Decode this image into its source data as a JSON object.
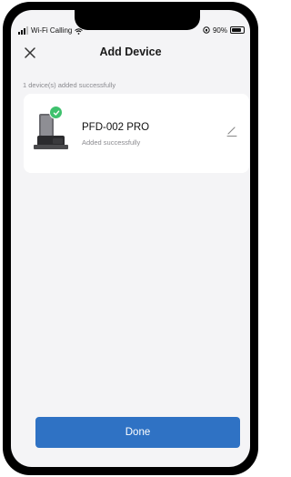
{
  "status_bar": {
    "carrier": "Wi-Fi Calling",
    "battery": "90%",
    "icons": [
      "signal-icon",
      "wifi-icon",
      "orientation-lock-icon",
      "battery-icon"
    ]
  },
  "header": {
    "title": "Add Device",
    "close_icon": "close-icon"
  },
  "summary": "1 device(s) added successfully",
  "devices": [
    {
      "name": "PFD-002 PRO",
      "status": "Added successfully",
      "icon": "pet-feeder-icon",
      "badge_icon": "check-icon",
      "action_icon": "edit-icon"
    }
  ],
  "done_label": "Done",
  "colors": {
    "accent": "#2f72c4",
    "success": "#3ec16d",
    "background": "#f4f4f6"
  }
}
